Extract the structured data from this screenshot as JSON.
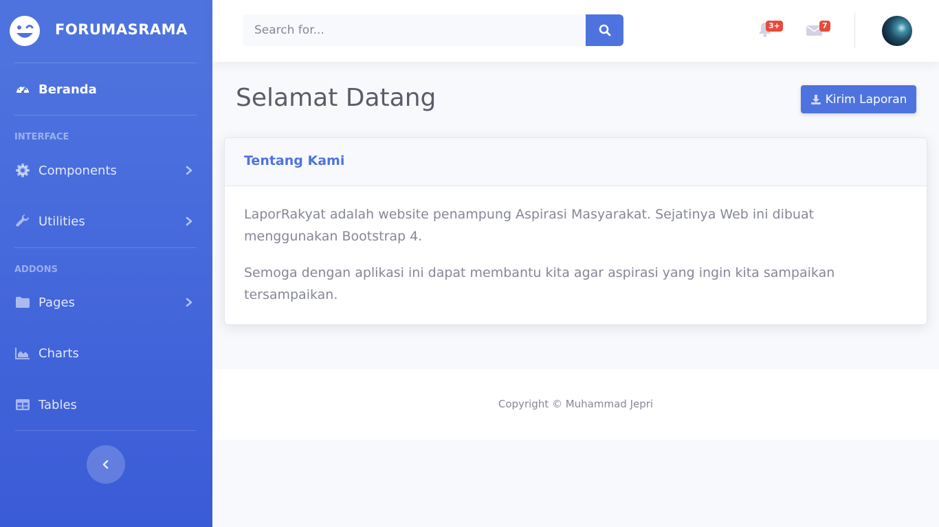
{
  "brand": {
    "name": "FORUMASRAMA",
    "icon": "laugh-wink-icon"
  },
  "sidebar": {
    "dashboard": {
      "label": "Beranda",
      "icon": "tachometer-icon"
    },
    "headings": {
      "interface": "INTERFACE",
      "addons": "ADDONS"
    },
    "items": [
      {
        "label": "Components",
        "icon": "cog-icon",
        "has_submenu": true
      },
      {
        "label": "Utilities",
        "icon": "wrench-icon",
        "has_submenu": true
      },
      {
        "label": "Pages",
        "icon": "folder-icon",
        "has_submenu": true
      },
      {
        "label": "Charts",
        "icon": "chart-area-icon",
        "has_submenu": false
      },
      {
        "label": "Tables",
        "icon": "table-icon",
        "has_submenu": false
      }
    ],
    "toggle_icon": "chevron-left-icon"
  },
  "topbar": {
    "search": {
      "placeholder": "Search for...",
      "value": ""
    },
    "alerts": {
      "icon": "bell-icon",
      "badge": "3+"
    },
    "messages": {
      "icon": "envelope-icon",
      "badge": "7"
    },
    "user": {
      "icon": "avatar"
    }
  },
  "main": {
    "title": "Selamat Datang",
    "report_button": {
      "label": "Kirim Laporan",
      "icon": "download-icon"
    },
    "card": {
      "title": "Tentang Kami",
      "paragraphs": [
        "LaporRakyat adalah website penampung Aspirasi Masyarakat. Sejatinya Web ini dibuat menggunakan Bootstrap 4.",
        "Semoga dengan aplikasi ini dapat membantu kita agar aspirasi yang ingin kita sampaikan tersampaikan."
      ]
    }
  },
  "footer": {
    "copyright": "Copyright © Muhammad Jepri"
  },
  "colors": {
    "primary": "#4e73df",
    "danger": "#e74a3b",
    "text": "#858796",
    "heading": "#5a5c69"
  }
}
